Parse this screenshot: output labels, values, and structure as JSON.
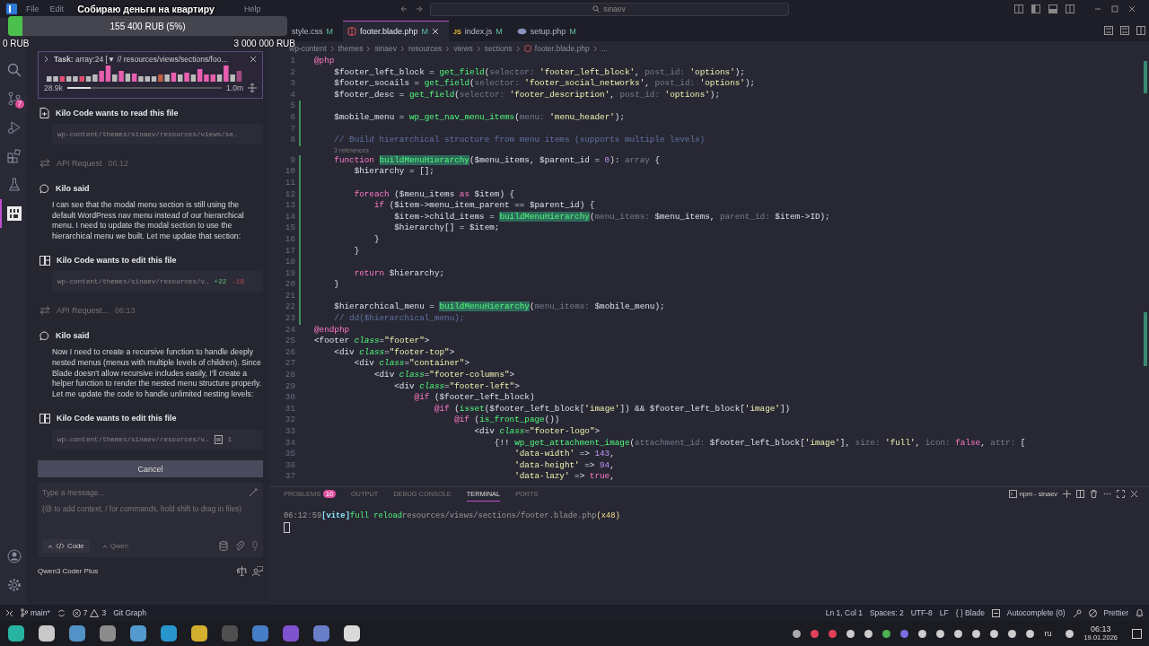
{
  "titlebar": {
    "menu": [
      "File",
      "Edit",
      "Help"
    ],
    "search": "sinaev"
  },
  "fundraiser": {
    "title": "Собираю деньги на квартиру",
    "level": 0.05,
    "amount": "155 400 RUB (5%)",
    "min": "0 RUB",
    "max": "3 000 000 RUB"
  },
  "activity_bar": {
    "items": [
      {
        "kind": "search",
        "selected": false
      },
      {
        "kind": "git",
        "selected": false,
        "badge": "7"
      },
      {
        "kind": "debug",
        "selected": false
      },
      {
        "kind": "extensions",
        "selected": false
      },
      {
        "kind": "testing",
        "selected": false
      },
      {
        "kind": "kilo",
        "selected": true
      }
    ],
    "bottom": [
      {
        "kind": "account"
      },
      {
        "kind": "settings"
      }
    ]
  },
  "task_widget": {
    "label": "Task:",
    "text": "array:24 [▼ // resources/views/sections/foo...",
    "range_start": "28.9k",
    "range_end": "1.0m",
    "level": 0.15
  },
  "chat": {
    "messages": [
      {
        "kind": "read",
        "title": "Kilo Code wants to read this file",
        "path": "wp-content/themes/sinaev/resources/views/se…"
      },
      {
        "kind": "api",
        "title": "API Request",
        "time": "06:12"
      },
      {
        "kind": "said",
        "title": "Kilo said",
        "text": "I can see that the modal menu section is still using the default WordPress nav menu instead of our hierarchical menu. I need to update the modal section to use the hierarchical menu we built. Let me update that section:"
      },
      {
        "kind": "edit",
        "title": "Kilo Code wants to edit this file",
        "path": "wp-content/themes/sinaev/resources/v…",
        "added": "+22",
        "removed": "-18"
      },
      {
        "kind": "api",
        "title": "API Request...",
        "time": "06:13"
      },
      {
        "kind": "said",
        "title": "Kilo said",
        "text": "Now I need to create a recursive function to handle deeply nested menus (menus with multiple levels of children). Since Blade doesn't allow recursive includes easily, I'll create a helper function to render the nested menu structure properly. Let me update the code to handle unlimited nesting levels:"
      },
      {
        "kind": "edit",
        "title": "Kilo Code wants to edit this file",
        "path": "wp-content/themes/sinaev/resources/v…",
        "count": "1"
      }
    ],
    "cancel": "Cancel",
    "input": {
      "placeholder": "Type a message...",
      "hint": "(@ to add context, / for commands, hold shift to drag in files)"
    },
    "mode": "Code",
    "provider": "Qwen",
    "model": "Qwen3 Coder Plus"
  },
  "tabs": [
    {
      "kind": "css",
      "label": "style.css",
      "status": "M",
      "selected": false
    },
    {
      "kind": "blade",
      "label": "footer.blade.php",
      "status": "M",
      "selected": true
    },
    {
      "kind": "js",
      "icon": "JS",
      "label": "index.js",
      "status": "M",
      "selected": false
    },
    {
      "kind": "php",
      "label": "setup.php",
      "status": "M",
      "selected": false
    }
  ],
  "breadcrumb": [
    "wp-content",
    "themes",
    "sinaev",
    "resources",
    "views",
    "sections",
    "footer.blade.php",
    "..."
  ],
  "code": {
    "lines": [
      {
        "number": "1",
        "changed": false,
        "tokens": [
          {
            "kind": "kw",
            "text": "@php"
          }
        ]
      },
      {
        "number": "2",
        "changed": false,
        "tokens": [
          {
            "kind": "plain",
            "text": "    $footer_left_block = "
          },
          {
            "kind": "fn",
            "text": "get_field"
          },
          {
            "kind": "plain",
            "text": "("
          },
          {
            "kind": "hint",
            "text": "selector: "
          },
          {
            "kind": "str",
            "text": "'footer_left_block'"
          },
          {
            "kind": "plain",
            "text": ", "
          },
          {
            "kind": "hint",
            "text": "post_id: "
          },
          {
            "kind": "str",
            "text": "'options'"
          },
          {
            "kind": "plain",
            "text": ");"
          }
        ]
      },
      {
        "number": "3",
        "changed": false,
        "tokens": [
          {
            "kind": "plain",
            "text": "    $footer_socails = "
          },
          {
            "kind": "fn",
            "text": "get_field"
          },
          {
            "kind": "plain",
            "text": "("
          },
          {
            "kind": "hint",
            "text": "selector: "
          },
          {
            "kind": "str",
            "text": "'footer_social_networks'"
          },
          {
            "kind": "plain",
            "text": ", "
          },
          {
            "kind": "hint",
            "text": "post_id: "
          },
          {
            "kind": "str",
            "text": "'options'"
          },
          {
            "kind": "plain",
            "text": ");"
          }
        ]
      },
      {
        "number": "4",
        "changed": false,
        "tokens": [
          {
            "kind": "plain",
            "text": "    $footer_desc = "
          },
          {
            "kind": "fn",
            "text": "get_field"
          },
          {
            "kind": "plain",
            "text": "("
          },
          {
            "kind": "hint",
            "text": "selector: "
          },
          {
            "kind": "str",
            "text": "'footer_description'"
          },
          {
            "kind": "plain",
            "text": ", "
          },
          {
            "kind": "hint",
            "text": "post_id: "
          },
          {
            "kind": "str",
            "text": "'options'"
          },
          {
            "kind": "plain",
            "text": ");"
          }
        ]
      },
      {
        "number": "5",
        "changed": true
      },
      {
        "number": "6",
        "changed": true,
        "tokens": [
          {
            "kind": "plain",
            "text": "    $mobile_menu = "
          },
          {
            "kind": "fn",
            "text": "wp_get_nav_menu_items"
          },
          {
            "kind": "plain",
            "text": "("
          },
          {
            "kind": "hint",
            "text": "menu: "
          },
          {
            "kind": "str",
            "text": "'menu_header'"
          },
          {
            "kind": "plain",
            "text": ");"
          }
        ]
      },
      {
        "number": "7",
        "changed": true
      },
      {
        "number": "8",
        "changed": true,
        "tokens": [
          {
            "kind": "cmt",
            "text": "    // Build hierarchical structure from menu items (supports multiple levels)"
          }
        ]
      },
      {
        "number": "9",
        "changed": true,
        "codelens": "3 references",
        "tokens": [
          {
            "kind": "kw",
            "text": "    function "
          },
          {
            "kind": "hl",
            "text": "buildMenuHierarchy"
          },
          {
            "kind": "plain",
            "text": "($menu_items, $parent_id = "
          },
          {
            "kind": "num",
            "text": "0"
          },
          {
            "kind": "plain",
            "text": "): "
          },
          {
            "kind": "hint",
            "text": "array"
          },
          {
            "kind": "plain",
            "text": " {"
          }
        ]
      },
      {
        "number": "10",
        "changed": true,
        "tokens": [
          {
            "kind": "plain",
            "text": "        $hierarchy = [];"
          }
        ]
      },
      {
        "number": "11",
        "changed": true
      },
      {
        "number": "12",
        "changed": true,
        "tokens": [
          {
            "kind": "kw",
            "text": "        foreach"
          },
          {
            "kind": "plain",
            "text": " ($menu_items "
          },
          {
            "kind": "kw",
            "text": "as"
          },
          {
            "kind": "plain",
            "text": " $item) {"
          }
        ]
      },
      {
        "number": "13",
        "changed": true,
        "tokens": [
          {
            "kind": "kw",
            "text": "            if"
          },
          {
            "kind": "plain",
            "text": " ($item->menu_item_parent == $parent_id) {"
          }
        ]
      },
      {
        "number": "14",
        "changed": true,
        "tokens": [
          {
            "kind": "plain",
            "text": "                $item->child_items = "
          },
          {
            "kind": "hl",
            "text": "buildMenuHierarchy"
          },
          {
            "kind": "plain",
            "text": "("
          },
          {
            "kind": "hint",
            "text": "menu_items: "
          },
          {
            "kind": "plain",
            "text": "$menu_items, "
          },
          {
            "kind": "hint",
            "text": "parent_id: "
          },
          {
            "kind": "plain",
            "text": "$item->ID);"
          }
        ]
      },
      {
        "number": "15",
        "changed": true,
        "tokens": [
          {
            "kind": "plain",
            "text": "                $hierarchy[] = $item;"
          }
        ]
      },
      {
        "number": "16",
        "changed": true,
        "tokens": [
          {
            "kind": "plain",
            "text": "            }"
          }
        ]
      },
      {
        "number": "17",
        "changed": true,
        "tokens": [
          {
            "kind": "plain",
            "text": "        }"
          }
        ]
      },
      {
        "number": "18",
        "changed": true
      },
      {
        "number": "19",
        "changed": true,
        "tokens": [
          {
            "kind": "kw",
            "text": "        return"
          },
          {
            "kind": "plain",
            "text": " $hierarchy;"
          }
        ]
      },
      {
        "number": "20",
        "changed": true,
        "tokens": [
          {
            "kind": "plain",
            "text": "    }"
          }
        ]
      },
      {
        "number": "21",
        "changed": true
      },
      {
        "number": "22",
        "changed": true,
        "tokens": [
          {
            "kind": "plain",
            "text": "    $hierarchical_menu = "
          },
          {
            "kind": "hl",
            "text": "buildMenuHierarchy"
          },
          {
            "kind": "plain",
            "text": "("
          },
          {
            "kind": "hint",
            "text": "menu_items: "
          },
          {
            "kind": "plain",
            "text": "$mobile_menu);"
          }
        ]
      },
      {
        "number": "23",
        "changed": true,
        "tokens": [
          {
            "kind": "cmt",
            "text": "    // dd($hierarchical_menu);"
          }
        ]
      },
      {
        "number": "24",
        "changed": false,
        "tokens": [
          {
            "kind": "kw",
            "text": "@endphp"
          }
        ]
      },
      {
        "number": "25",
        "changed": false,
        "tokens": [
          {
            "kind": "plain",
            "text": "<footer "
          },
          {
            "kind": "attr",
            "text": "class"
          },
          {
            "kind": "plain",
            "text": "="
          },
          {
            "kind": "str",
            "text": "\"footer\""
          },
          {
            "kind": "plain",
            "text": ">"
          }
        ]
      },
      {
        "number": "26",
        "changed": false,
        "tokens": [
          {
            "kind": "plain",
            "text": "    <div "
          },
          {
            "kind": "attr",
            "text": "class"
          },
          {
            "kind": "plain",
            "text": "="
          },
          {
            "kind": "str",
            "text": "\"footer-top\""
          },
          {
            "kind": "plain",
            "text": ">"
          }
        ]
      },
      {
        "number": "27",
        "changed": false,
        "tokens": [
          {
            "kind": "plain",
            "text": "        <div "
          },
          {
            "kind": "attr",
            "text": "class"
          },
          {
            "kind": "plain",
            "text": "="
          },
          {
            "kind": "str",
            "text": "\"container\""
          },
          {
            "kind": "plain",
            "text": ">"
          }
        ]
      },
      {
        "number": "28",
        "changed": false,
        "tokens": [
          {
            "kind": "plain",
            "text": "            <div "
          },
          {
            "kind": "attr",
            "text": "class"
          },
          {
            "kind": "plain",
            "text": "="
          },
          {
            "kind": "str",
            "text": "\"footer-columns\""
          },
          {
            "kind": "plain",
            "text": ">"
          }
        ]
      },
      {
        "number": "29",
        "changed": false,
        "tokens": [
          {
            "kind": "plain",
            "text": "                <div "
          },
          {
            "kind": "attr",
            "text": "class"
          },
          {
            "kind": "plain",
            "text": "="
          },
          {
            "kind": "str",
            "text": "\"footer-left\""
          },
          {
            "kind": "plain",
            "text": ">"
          }
        ]
      },
      {
        "number": "30",
        "changed": false,
        "tokens": [
          {
            "kind": "kw",
            "text": "                    @if"
          },
          {
            "kind": "plain",
            "text": " ($footer_left_block)"
          }
        ]
      },
      {
        "number": "31",
        "changed": false,
        "tokens": [
          {
            "kind": "kw",
            "text": "                        @if"
          },
          {
            "kind": "plain",
            "text": " ("
          },
          {
            "kind": "fn",
            "text": "isset"
          },
          {
            "kind": "plain",
            "text": "($footer_left_block["
          },
          {
            "kind": "str",
            "text": "'image'"
          },
          {
            "kind": "plain",
            "text": "]) && $footer_left_block["
          },
          {
            "kind": "str",
            "text": "'image'"
          },
          {
            "kind": "plain",
            "text": "])"
          }
        ]
      },
      {
        "number": "32",
        "changed": false,
        "tokens": [
          {
            "kind": "kw",
            "text": "                            @if"
          },
          {
            "kind": "plain",
            "text": " ("
          },
          {
            "kind": "fn",
            "text": "is_front_page"
          },
          {
            "kind": "plain",
            "text": "())"
          }
        ]
      },
      {
        "number": "33",
        "changed": false,
        "tokens": [
          {
            "kind": "plain",
            "text": "                                <div "
          },
          {
            "kind": "attr",
            "text": "class"
          },
          {
            "kind": "plain",
            "text": "="
          },
          {
            "kind": "str",
            "text": "\"footer-logo\""
          },
          {
            "kind": "plain",
            "text": ">"
          }
        ]
      },
      {
        "number": "34",
        "changed": false,
        "tokens": [
          {
            "kind": "plain",
            "text": "                                    {!! "
          },
          {
            "kind": "fn",
            "text": "wp_get_attachment_image"
          },
          {
            "kind": "plain",
            "text": "("
          },
          {
            "kind": "hint",
            "text": "attachment_id: "
          },
          {
            "kind": "plain",
            "text": "$footer_left_block["
          },
          {
            "kind": "str",
            "text": "'image'"
          },
          {
            "kind": "plain",
            "text": "], "
          },
          {
            "kind": "hint",
            "text": "size: "
          },
          {
            "kind": "str",
            "text": "'full'"
          },
          {
            "kind": "plain",
            "text": ", "
          },
          {
            "kind": "hint",
            "text": "icon: "
          },
          {
            "kind": "kw",
            "text": "false"
          },
          {
            "kind": "plain",
            "text": ", "
          },
          {
            "kind": "hint",
            "text": "attr: "
          },
          {
            "kind": "plain",
            "text": "["
          }
        ]
      },
      {
        "number": "35",
        "changed": false,
        "tokens": [
          {
            "kind": "str",
            "text": "                                        'data-width'"
          },
          {
            "kind": "plain",
            "text": " => "
          },
          {
            "kind": "num",
            "text": "143"
          },
          {
            "kind": "plain",
            "text": ","
          }
        ]
      },
      {
        "number": "36",
        "changed": false,
        "tokens": [
          {
            "kind": "str",
            "text": "                                        'data-height'"
          },
          {
            "kind": "plain",
            "text": " => "
          },
          {
            "kind": "num",
            "text": "94"
          },
          {
            "kind": "plain",
            "text": ","
          }
        ]
      },
      {
        "number": "37",
        "changed": false,
        "tokens": [
          {
            "kind": "str",
            "text": "                                        'data-lazy'"
          },
          {
            "kind": "plain",
            "text": " => "
          },
          {
            "kind": "kw",
            "text": "true"
          },
          {
            "kind": "plain",
            "text": ","
          }
        ]
      }
    ]
  },
  "panel": {
    "tabs": [
      {
        "label": "PROBLEMS",
        "badge": "10",
        "selected": false
      },
      {
        "label": "OUTPUT",
        "selected": false
      },
      {
        "label": "DEBUG CONSOLE",
        "selected": false
      },
      {
        "label": "TERMINAL",
        "selected": true
      },
      {
        "label": "PORTS",
        "selected": false
      }
    ],
    "terminal_name": "npm - sinaev",
    "terminal_lines": [
      [
        {
          "kind": "time",
          "text": "06:12:59"
        },
        {
          "kind": "tag",
          "text": "[vite]"
        },
        {
          "kind": "action",
          "text": "full reload"
        },
        {
          "kind": "path",
          "text": "resources/views/sections/footer.blade.php"
        },
        {
          "kind": "count",
          "text": "(x48)"
        }
      ]
    ]
  },
  "status_bar": {
    "branch": "main*",
    "errors": "7",
    "warnings": "3",
    "git_graph": "Git Graph",
    "right": [
      {
        "text": "Ln 1, Col 1"
      },
      {
        "text": "Spaces: 2"
      },
      {
        "text": "UTF-8"
      },
      {
        "text": "LF"
      },
      {
        "prefix": "{ }",
        "text": "Blade"
      },
      {
        "kind": "autocomplete",
        "text": "Autocomplete (0)"
      },
      {
        "kind": "prettier",
        "text": "Prettier"
      }
    ]
  },
  "taskbar": {
    "language": "ru",
    "time": "06:13",
    "date": "19.01.2026"
  }
}
